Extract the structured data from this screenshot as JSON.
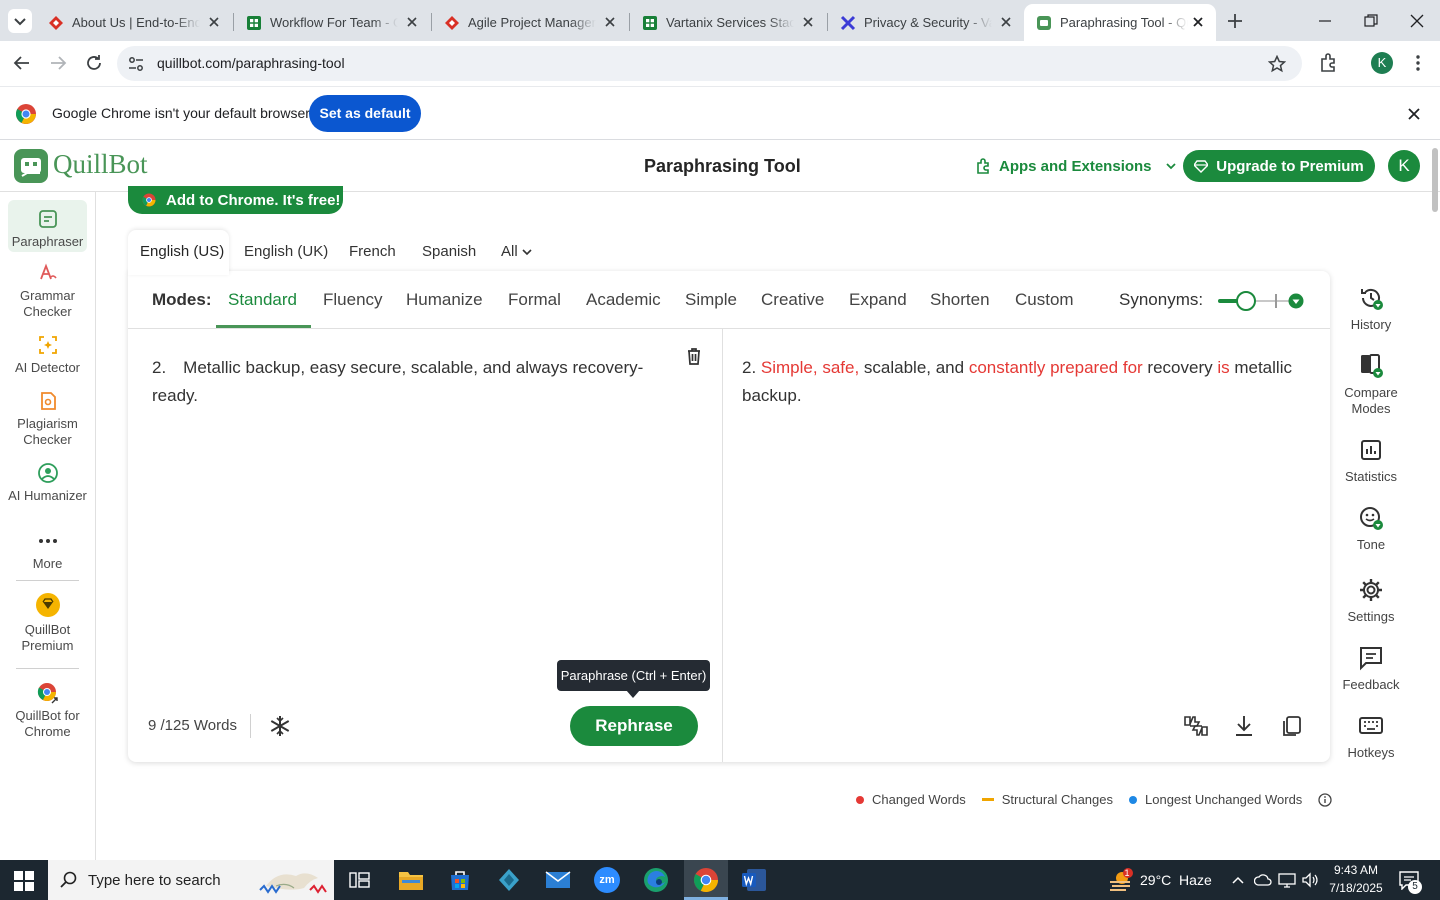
{
  "browser": {
    "tabs": [
      {
        "title": "About Us | End-to-End",
        "icon": "diamond-red-icon"
      },
      {
        "title": "Workflow For Team - Go",
        "icon": "sheets-icon"
      },
      {
        "title": "Agile Project Manageme",
        "icon": "diamond-red-icon"
      },
      {
        "title": "Vartanix Services Stack",
        "icon": "sheets-icon"
      },
      {
        "title": "Privacy & Security - Var",
        "icon": "x-logo-icon"
      },
      {
        "title": "Paraphrasing Tool - Qui",
        "icon": "quillbot-icon",
        "active": true
      }
    ],
    "url": "quillbot.com/paraphrasing-tool",
    "profile_initial": "K",
    "infobar": {
      "message": "Google Chrome isn't your default browser",
      "button": "Set as default"
    }
  },
  "header": {
    "logo": "QuillBot",
    "page_title": "Paraphrasing Tool",
    "apps_label": "Apps and Extensions",
    "upgrade_label": "Upgrade to Premium",
    "avatar_initial": "K"
  },
  "sidebar": {
    "items": [
      {
        "label": "Paraphraser",
        "icon": "paraphraser-icon",
        "active": true
      },
      {
        "label": "Grammar Checker",
        "icon": "grammar-icon"
      },
      {
        "label": "AI Detector",
        "icon": "ai-detector-icon"
      },
      {
        "label": "Plagiarism Checker",
        "icon": "plagiarism-icon"
      },
      {
        "label": "AI Humanizer",
        "icon": "humanizer-icon"
      },
      {
        "label": "More",
        "icon": "more-dots-icon"
      },
      {
        "label": "QuillBot Premium",
        "icon": "premium-gem-icon"
      },
      {
        "label": "QuillBot for Chrome",
        "icon": "chrome-icon"
      }
    ]
  },
  "promo": {
    "label": "Add to Chrome. It's free!"
  },
  "languages": [
    "English (US)",
    "English (UK)",
    "French",
    "Spanish",
    "All"
  ],
  "modes": {
    "label": "Modes:",
    "items": [
      "Standard",
      "Fluency",
      "Humanize",
      "Formal",
      "Academic",
      "Simple",
      "Creative",
      "Expand",
      "Shorten",
      "Custom"
    ],
    "active": "Standard",
    "synonyms_label": "Synonyms:"
  },
  "input": {
    "text": "2. Metallic backup, easy secure, scalable, and always recovery-ready.",
    "word_count": "9 /125 Words",
    "rephrase_label": "Rephrase",
    "tooltip": "Paraphrase (Ctrl + Enter)"
  },
  "output": {
    "segments": [
      {
        "text": "2. ",
        "changed": false
      },
      {
        "text": "Simple, safe,",
        "changed": true
      },
      {
        "text": " scalable, and ",
        "changed": false
      },
      {
        "text": "constantly prepared for",
        "changed": true
      },
      {
        "text": " recovery ",
        "changed": false
      },
      {
        "text": "is",
        "changed": true
      },
      {
        "text": " metallic backup.",
        "changed": false
      }
    ]
  },
  "legend": [
    {
      "label": "Changed Words",
      "color": "#e53935"
    },
    {
      "label": "Structural Changes",
      "color": "#f0a500"
    },
    {
      "label": "Longest Unchanged Words",
      "color": "#1e88e5"
    }
  ],
  "right_rail": [
    {
      "label": "History",
      "icon": "history-icon"
    },
    {
      "label": "Compare Modes",
      "icon": "compare-icon"
    },
    {
      "label": "Statistics",
      "icon": "statistics-icon"
    },
    {
      "label": "Tone",
      "icon": "tone-icon"
    },
    {
      "label": "Settings",
      "icon": "gear-icon"
    },
    {
      "label": "Feedback",
      "icon": "feedback-icon"
    },
    {
      "label": "Hotkeys",
      "icon": "keyboard-icon"
    }
  ],
  "taskbar": {
    "search_placeholder": "Type here to search",
    "weather": "29°C  Haze",
    "time": "9:43 AM",
    "date": "7/18/2025",
    "notification_count": "5",
    "weather_badge": "1"
  },
  "colors": {
    "brand_green": "#499557",
    "dark_green": "#1b8a3d",
    "changed": "#e53935"
  }
}
